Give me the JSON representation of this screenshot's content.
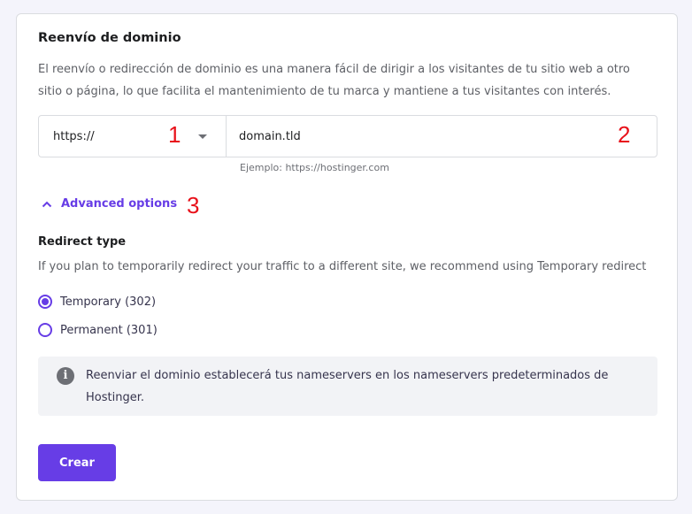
{
  "card": {
    "title": "Reenvío de dominio",
    "description": "El reenvío o redirección de dominio es una manera fácil de dirigir a los visitantes de tu sitio web a otro sitio o página, lo que facilita el mantenimiento de tu marca y mantiene a tus visitantes con interés.",
    "protocol_select": {
      "value": "https://"
    },
    "domain_input": {
      "value": "domain.tld"
    },
    "hint": "Ejemplo: https://hostinger.com",
    "advanced_toggle": "Advanced options",
    "redirect_type": {
      "label": "Redirect type",
      "description": "If you plan to temporarily redirect your traffic to a different site, we recommend using Temporary redirect",
      "options": [
        {
          "label": "Temporary (302)",
          "selected": true
        },
        {
          "label": "Permanent (301)",
          "selected": false
        }
      ]
    },
    "info_icon": "info-icon",
    "info_text": "Reenviar el dominio establecerá tus nameservers en los nameservers predeterminados de Hostinger.",
    "create_button": "Crear"
  },
  "annotations": [
    "1",
    "2",
    "3"
  ],
  "colors": {
    "accent": "#673de6",
    "annotation": "#e8111a"
  }
}
